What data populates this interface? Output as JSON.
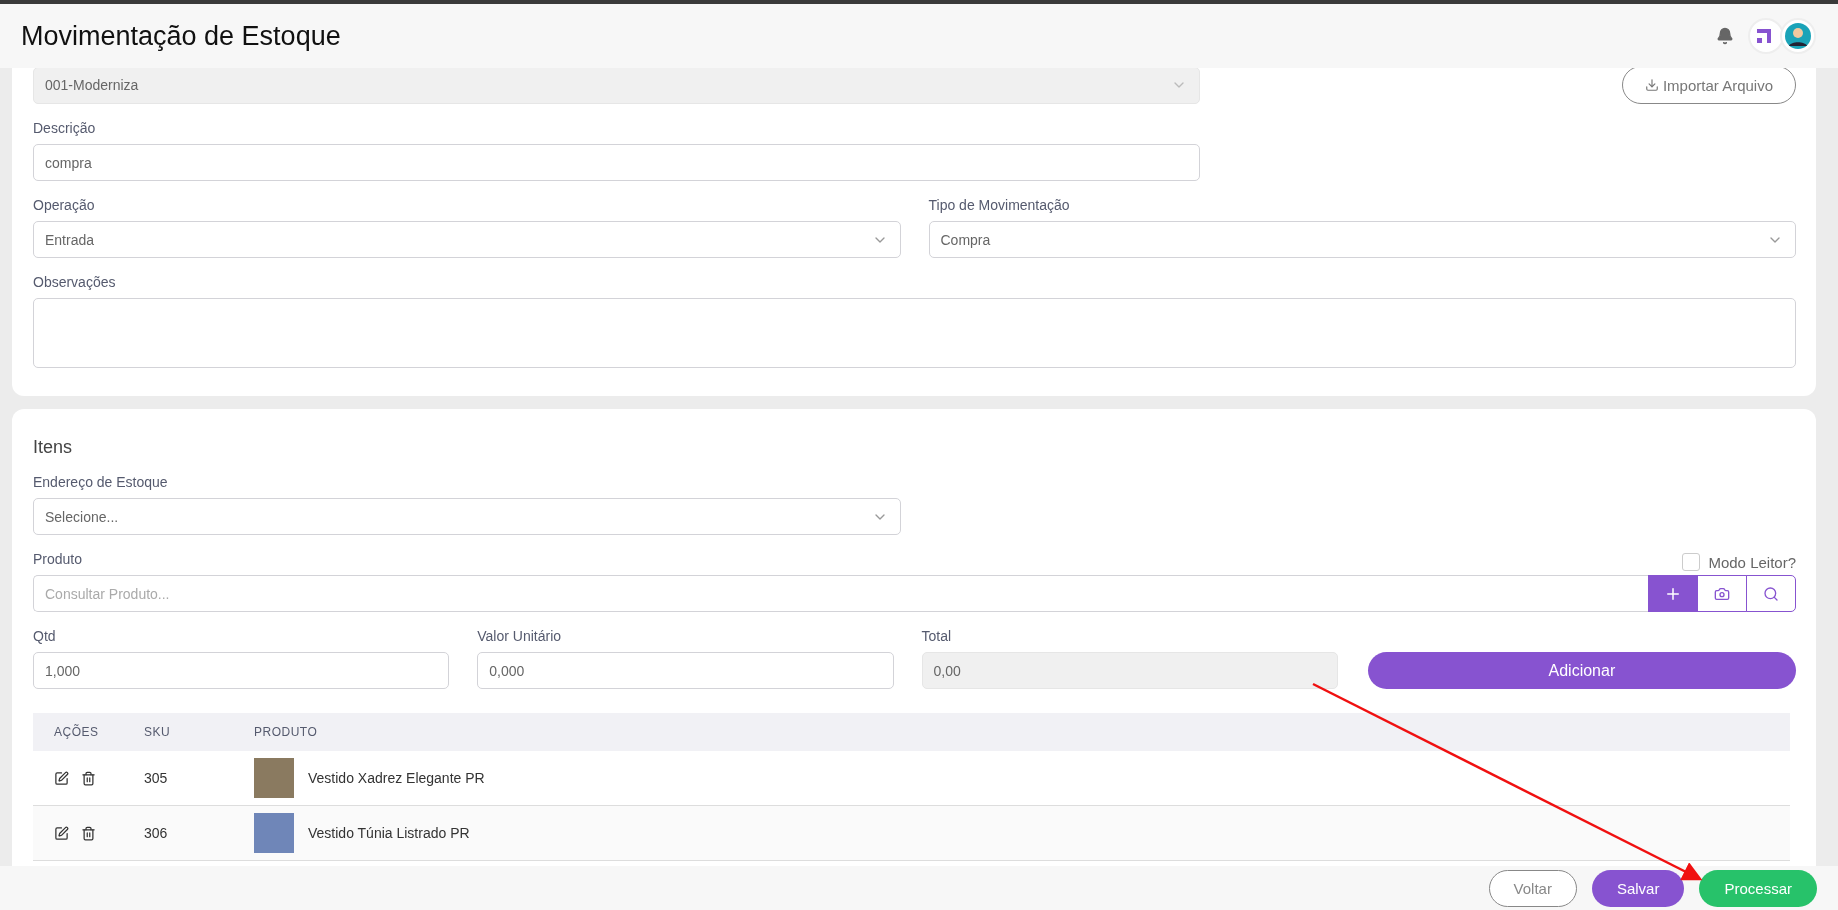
{
  "header": {
    "title": "Movimentação de Estoque"
  },
  "import_button": {
    "label": "Importar Arquivo"
  },
  "company_select": {
    "value": "001-Moderniza",
    "disabled": true
  },
  "description": {
    "label": "Descrição",
    "value": "compra"
  },
  "operation": {
    "label": "Operação",
    "value": "Entrada"
  },
  "movement_type": {
    "label": "Tipo de Movimentação",
    "value": "Compra"
  },
  "notes": {
    "label": "Observações"
  },
  "items_section": {
    "title": "Itens",
    "stock_address": {
      "label": "Endereço de Estoque",
      "value": "Selecione..."
    },
    "product": {
      "label": "Produto",
      "placeholder": "Consultar Produto..."
    },
    "reader_mode": {
      "label": "Modo Leitor?",
      "checked": false
    },
    "quantity": {
      "label": "Qtd",
      "value": "1,000"
    },
    "unit_value": {
      "label": "Valor Unitário",
      "value": "0,000"
    },
    "total": {
      "label": "Total",
      "value": "0,00",
      "disabled": true
    },
    "add_button": {
      "label": "Adicionar"
    },
    "table": {
      "columns": [
        "AÇÕES",
        "SKU",
        "PRODUTO"
      ],
      "rows": [
        {
          "sku": "305",
          "product": "Vestido Xadrez Elegante PR"
        },
        {
          "sku": "306",
          "product": "Vestido Túnia Listrado PR"
        }
      ]
    }
  },
  "footer": {
    "buttons": [
      {
        "label": "Voltar",
        "kind": "outline"
      },
      {
        "label": "Salvar",
        "kind": "primary"
      },
      {
        "label": "Processar",
        "kind": "success"
      }
    ]
  }
}
